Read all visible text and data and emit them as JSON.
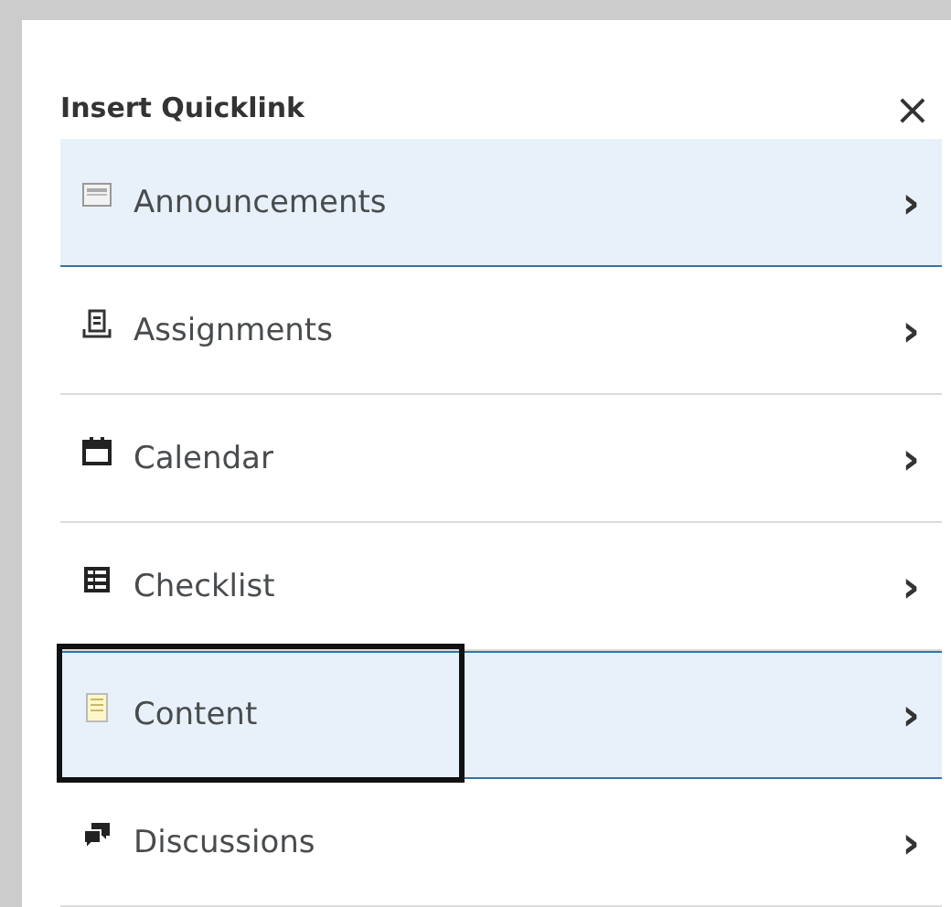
{
  "dialog": {
    "title": "Insert Quicklink",
    "close": "×"
  },
  "items": [
    {
      "label": "Announcements",
      "highlighted": true,
      "outlined": false,
      "chevron": "›"
    },
    {
      "label": "Assignments",
      "highlighted": false,
      "outlined": false,
      "chevron": "›"
    },
    {
      "label": "Calendar",
      "highlighted": false,
      "outlined": false,
      "chevron": "›"
    },
    {
      "label": "Checklist",
      "highlighted": false,
      "outlined": false,
      "chevron": "›"
    },
    {
      "label": "Content",
      "highlighted": true,
      "outlined": true,
      "chevron": "›"
    },
    {
      "label": "Discussions",
      "highlighted": false,
      "outlined": false,
      "chevron": "›"
    }
  ]
}
